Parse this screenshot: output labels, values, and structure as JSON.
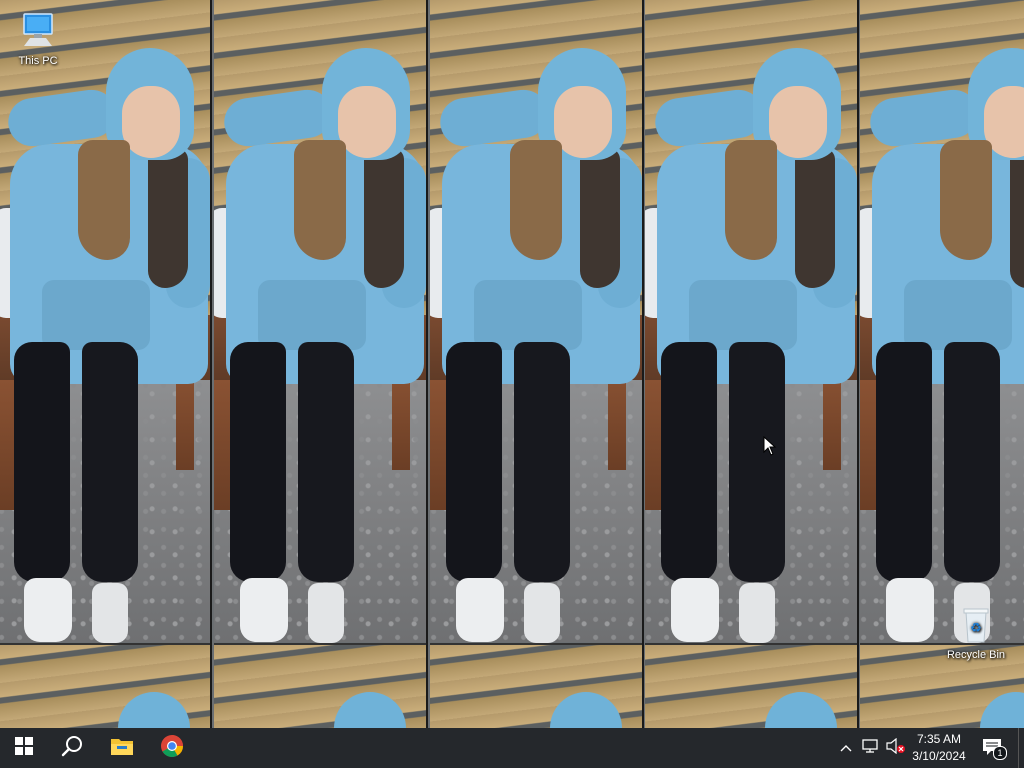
{
  "desktop": {
    "icons": [
      {
        "label": "This PC",
        "icon": "this-pc-icon"
      },
      {
        "label": "Recycle Bin",
        "icon": "recycle-bin-icon"
      }
    ]
  },
  "taskbar": {
    "start": {
      "icon": "windows-logo-icon"
    },
    "search": {
      "icon": "search-icon"
    },
    "pinned": [
      {
        "name": "File Explorer",
        "icon": "folder-icon"
      },
      {
        "name": "Google Chrome",
        "icon": "chrome-icon"
      }
    ],
    "tray": {
      "chevron_icon": "chevron-up-icon",
      "network_icon": "network-icon",
      "volume_icon": "volume-muted-icon",
      "time": "7:35 AM",
      "date": "3/10/2024",
      "notification_icon": "notification-icon",
      "notification_count": "1"
    }
  },
  "colors": {
    "taskbar": "#12161a",
    "accent_blue": "#0078d7",
    "hoodie": "#78b6dc"
  }
}
